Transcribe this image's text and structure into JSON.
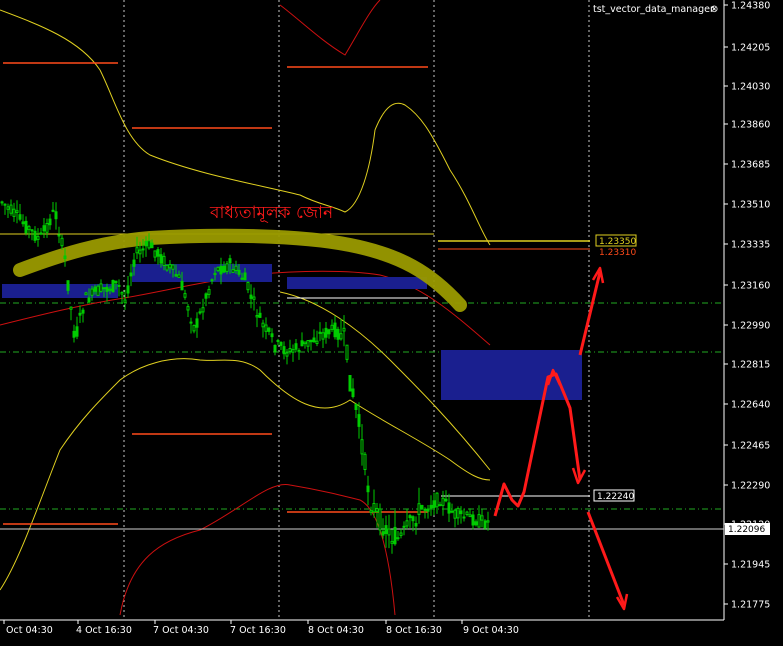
{
  "indicator": {
    "name": "tst_vector_data_manager",
    "close_glyph": "⊗"
  },
  "annotation": {
    "zone_text": "বাধ্যতামূলক জোন"
  },
  "colors": {
    "background": "#000000",
    "grid": "#c8c8c8",
    "candle": "#00cc00",
    "band_yellow": "#e0d020",
    "band_red": "#cc1010",
    "level_orange": "#ff4a1a",
    "zone_box": "#1a1f8f",
    "sketch": "#ff1a1a",
    "highlight": "#9a9a00",
    "dashdot": "#22aa22"
  },
  "price_axis": {
    "ticks": [
      "1.24380",
      "1.24205",
      "1.24030",
      "1.23860",
      "1.23685",
      "1.23510",
      "1.23335",
      "1.23160",
      "1.22990",
      "1.22815",
      "1.22640",
      "1.22465",
      "1.22290",
      "1.22120",
      "1.21945",
      "1.21775"
    ],
    "labels": {
      "upper_yellow": "1.23350",
      "upper_red": "1.23310",
      "white_level": "1.22240",
      "current": "1.22096"
    }
  },
  "time_axis": {
    "ticks": [
      "Oct 04:30",
      "4 Oct 16:30",
      "7 Oct 04:30",
      "7 Oct 16:30",
      "8 Oct 04:30",
      "8 Oct 16:30",
      "9 Oct 04:30"
    ]
  }
}
